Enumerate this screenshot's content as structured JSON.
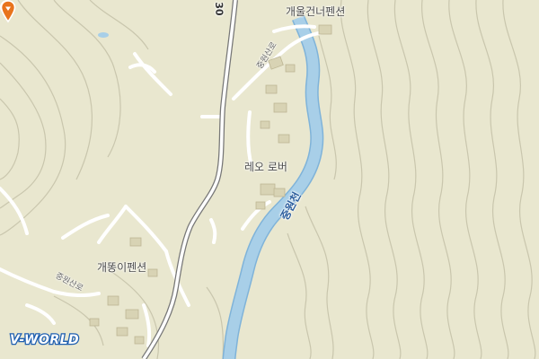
{
  "map": {
    "labels": {
      "place_top": "개울건너펜션",
      "place_center": "레오 로버",
      "place_left": "개똥이펜션",
      "road_top": "중원산로",
      "road_bottom": "중원산로",
      "river": "중원천",
      "route_number": "30"
    },
    "logo": "V-WORLD",
    "icons": {
      "marker": "location-pin-icon",
      "poi": "hotel-icon"
    },
    "colors": {
      "land": "#e9e7cf",
      "river": "#a8cfe8",
      "river_edge": "#7fb3d9",
      "road": "#ffffff",
      "main_road_edge": "#777777",
      "contour": "#c9c6ad",
      "marker": "#e8741c",
      "poi": "#e9b21a"
    }
  }
}
